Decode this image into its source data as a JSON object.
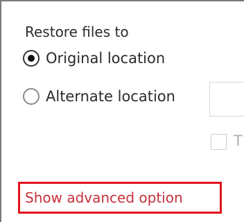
{
  "restore": {
    "heading": "Restore files to",
    "options": [
      {
        "label": "Original location",
        "selected": true
      },
      {
        "label": "Alternate location",
        "selected": false
      }
    ],
    "alternate_location_value": "",
    "sub_option_label": "T",
    "sub_option_checked": false
  },
  "advanced_link": {
    "label": "Show advanced option",
    "highlight_color": "#e3121f",
    "text_color": "#c4313b"
  }
}
